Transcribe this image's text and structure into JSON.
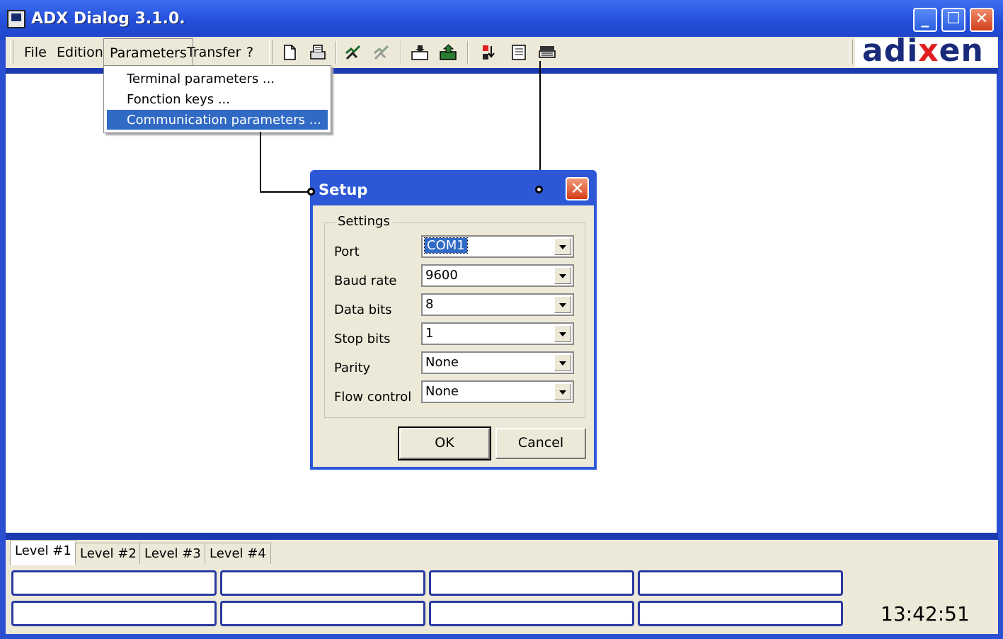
{
  "window": {
    "title": "ADX Dialog 3.1.0."
  },
  "menu": {
    "file": "File",
    "edition": "Edition",
    "parameters": "Parameters",
    "transfer": "Transfer",
    "help": "?"
  },
  "toolbar": {
    "icons": [
      "new-document-icon",
      "print-icon",
      "connect-icon",
      "disconnect-icon",
      "receive-icon",
      "send-icon",
      "swap-icon",
      "list-icon",
      "keyboard-icon"
    ]
  },
  "logo": {
    "text_main": "adi",
    "text_x": "x",
    "text_end": "en"
  },
  "parameters_menu": {
    "items": [
      "Terminal parameters ...",
      "Fonction keys ...",
      "Communication parameters ..."
    ],
    "selected_index": 2
  },
  "setup_dialog": {
    "title": "Setup",
    "group_label": "Settings",
    "fields": [
      {
        "label": "Port",
        "value": "COM1"
      },
      {
        "label": "Baud rate",
        "value": "9600"
      },
      {
        "label": "Data bits",
        "value": "8"
      },
      {
        "label": "Stop bits",
        "value": "1"
      },
      {
        "label": "Parity",
        "value": "None"
      },
      {
        "label": "Flow control",
        "value": "None"
      }
    ],
    "ok_label": "OK",
    "cancel_label": "Cancel"
  },
  "levels": {
    "tabs": [
      "Level #1",
      "Level #2",
      "Level #3",
      "Level #4"
    ],
    "active_index": 0
  },
  "status": {
    "clock": "13:42:51"
  },
  "colors": {
    "titlebar": "#2550dc",
    "selection": "#316ac5",
    "logo_dark": "#1a2a7a",
    "logo_red": "#e02020"
  }
}
